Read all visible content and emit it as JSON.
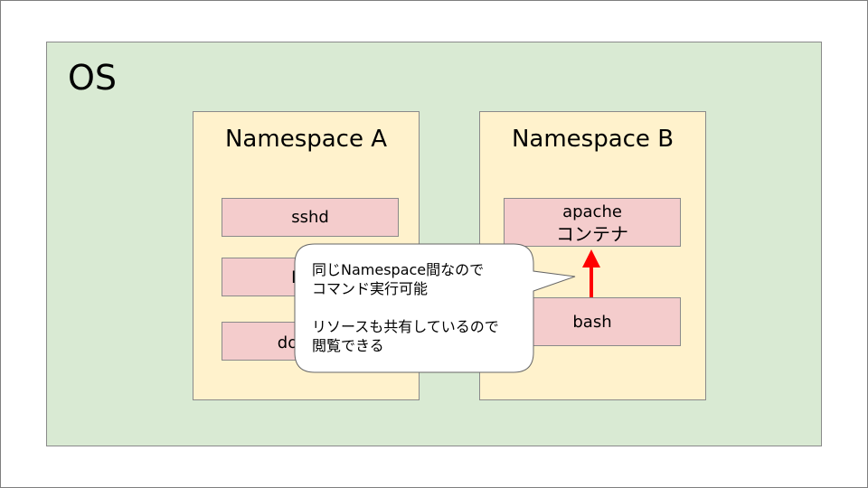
{
  "os": {
    "title": "OS"
  },
  "namespace_a": {
    "title": "Namespace A",
    "processes": [
      {
        "label": "sshd"
      },
      {
        "label": "b"
      },
      {
        "label": "do"
      }
    ]
  },
  "namespace_b": {
    "title": "Namespace B",
    "container": {
      "label_line1": "apache",
      "label_line2": "コンテナ"
    },
    "process": {
      "label": "bash"
    }
  },
  "callout": {
    "line1": "同じNamespace間なので",
    "line2": "コマンド実行可能",
    "line3": "リソースも共有しているので",
    "line4": "閲覧できる"
  },
  "colors": {
    "os_fill": "#d9ead3",
    "namespace_fill": "#fff2cc",
    "process_fill": "#f4cccc",
    "arrow": "#ff0000"
  }
}
